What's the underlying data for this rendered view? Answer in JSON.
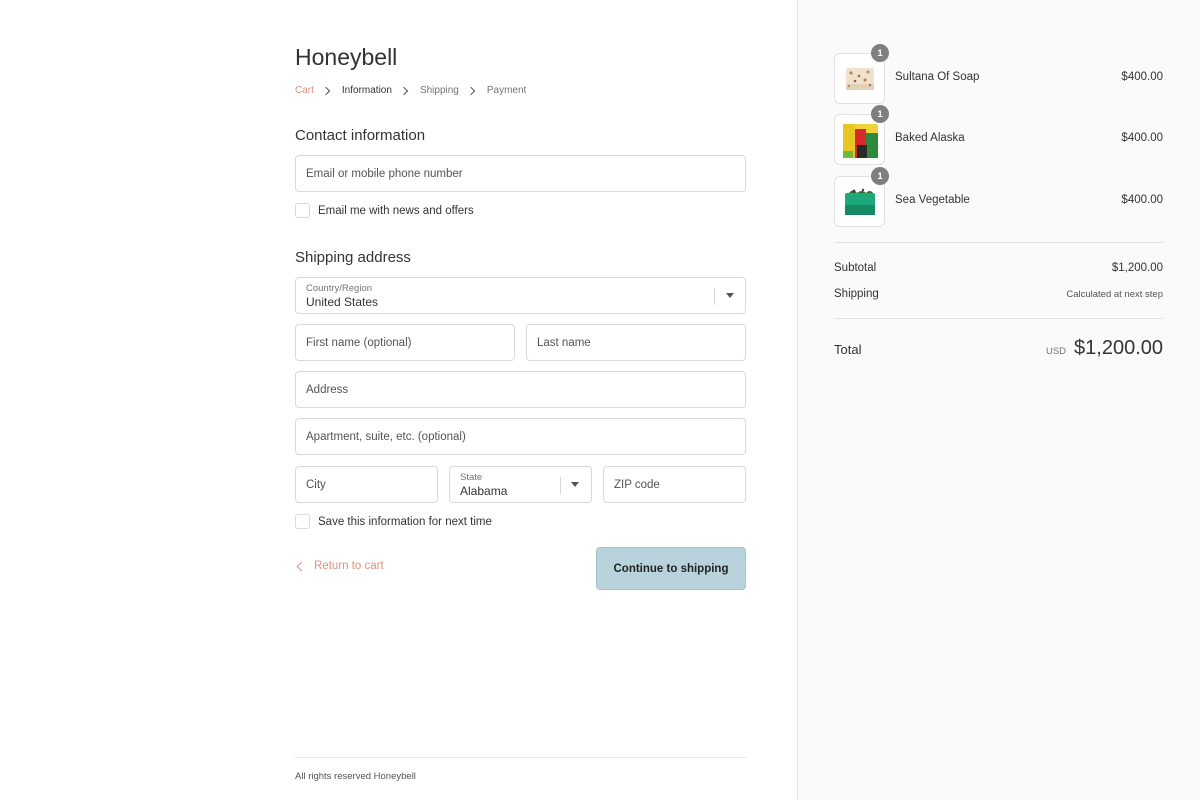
{
  "store": {
    "name": "Honeybell"
  },
  "breadcrumb": {
    "cart": "Cart",
    "information": "Information",
    "shipping": "Shipping",
    "payment": "Payment"
  },
  "contact": {
    "title": "Contact information",
    "email_placeholder": "Email or mobile phone number",
    "newsletter_label": "Email me with news and offers",
    "newsletter_checked": false
  },
  "shipping_address": {
    "title": "Shipping address",
    "country_label": "Country/Region",
    "country_value": "United States",
    "first_name_placeholder": "First name (optional)",
    "last_name_placeholder": "Last name",
    "address_placeholder": "Address",
    "apartment_placeholder": "Apartment, suite, etc. (optional)",
    "city_placeholder": "City",
    "state_label": "State",
    "state_value": "Alabama",
    "zip_placeholder": "ZIP code",
    "save_info_label": "Save this information for next time",
    "save_info_checked": false
  },
  "actions": {
    "return_label": "Return to cart",
    "continue_label": "Continue to shipping"
  },
  "footer": {
    "text": "All rights reserved Honeybell"
  },
  "order": {
    "items": [
      {
        "name": "Sultana Of Soap",
        "quantity": "1",
        "price": "$400.00"
      },
      {
        "name": "Baked Alaska",
        "quantity": "1",
        "price": "$400.00"
      },
      {
        "name": "Sea Vegetable",
        "quantity": "1",
        "price": "$400.00"
      }
    ],
    "subtotal_label": "Subtotal",
    "subtotal_value": "$1,200.00",
    "shipping_label": "Shipping",
    "shipping_value": "Calculated at next step",
    "total_label": "Total",
    "currency": "USD",
    "total_value": "$1,200.00"
  },
  "colors": {
    "accent_link": "#e0917d",
    "button_bg": "#b8d3dc",
    "sidebar_bg": "#fafafa",
    "qty_badge": "#7f7f7f"
  }
}
